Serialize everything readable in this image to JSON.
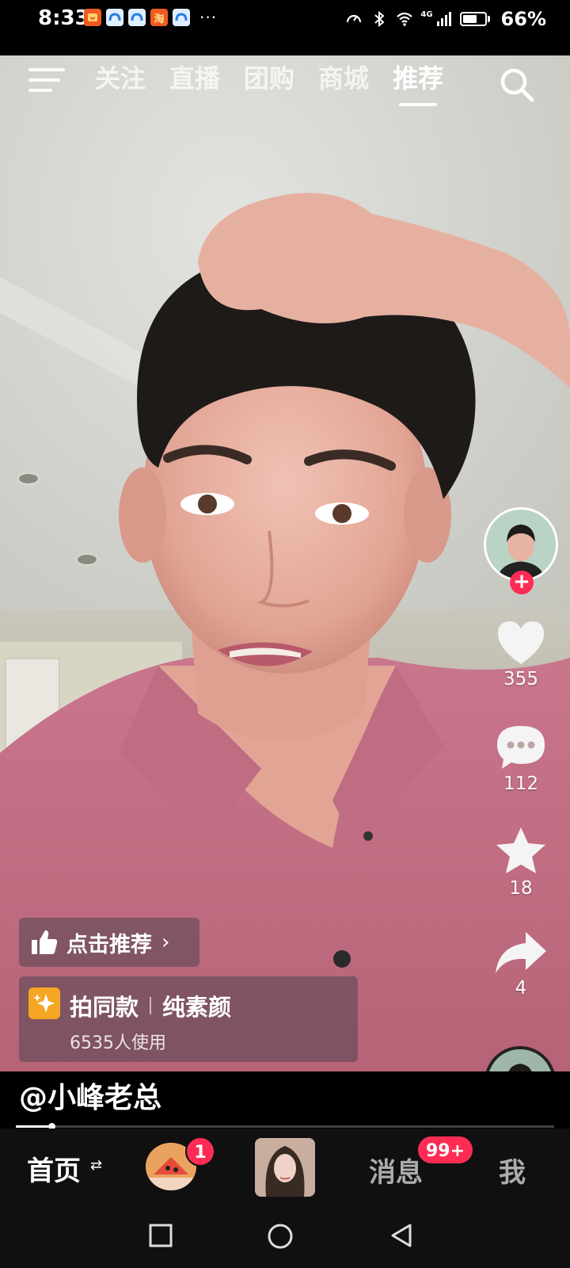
{
  "status_bar": {
    "time": "8:33",
    "notification_icons": [
      "taobao-red-icon",
      "cloud-app-icon",
      "cloud-app-icon",
      "taobao-icon",
      "cloud-app-icon"
    ],
    "taobao_glyph": "淘",
    "more": "···",
    "network": "4G",
    "battery_percent": "66%",
    "battery_level": 0.66
  },
  "top_nav": {
    "tabs": [
      {
        "label": "关注",
        "active": false
      },
      {
        "label": "直播",
        "active": false
      },
      {
        "label": "团购",
        "active": false
      },
      {
        "label": "商城",
        "active": false
      },
      {
        "label": "推荐",
        "active": true
      }
    ]
  },
  "actions": {
    "like_count": "355",
    "comment_count": "112",
    "favorite_count": "18",
    "share_count": "4",
    "follow_symbol": "+"
  },
  "overlay": {
    "recommend_label": "点击推荐",
    "recommend_chevron": "›",
    "effect_name": "拍同款",
    "effect_tag": "纯素颜",
    "effect_users": "6535人使用"
  },
  "author": "@小峰老总",
  "progress_fraction": 0.066,
  "bottom_nav": {
    "home": "首页",
    "swap_icon": "⇄",
    "friends_badge": "1",
    "messages": "消息",
    "messages_badge": "99+",
    "me": "我"
  },
  "colors": {
    "accent": "#fe2c55",
    "nav_bg": "#101010"
  }
}
